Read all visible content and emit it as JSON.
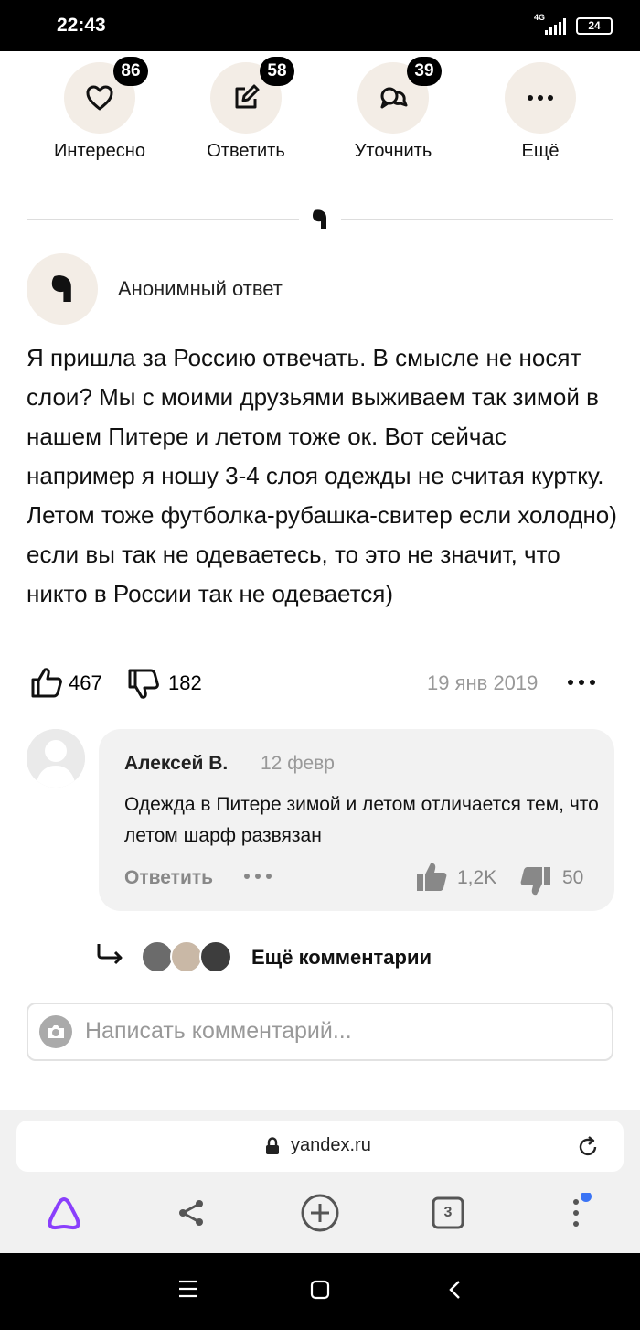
{
  "status_bar": {
    "time": "22:43",
    "network": "4G",
    "battery": "24"
  },
  "actions": [
    {
      "name": "interesting",
      "label": "Интересно",
      "count": "86",
      "icon": "heart-icon"
    },
    {
      "name": "answer",
      "label": "Ответить",
      "count": "58",
      "icon": "edit-icon"
    },
    {
      "name": "clarify",
      "label": "Уточнить",
      "count": "39",
      "icon": "chat-bubbles-icon"
    },
    {
      "name": "more",
      "label": "Ещё",
      "count": null,
      "icon": "more-dots-icon"
    }
  ],
  "answer": {
    "author": "Анонимный ответ",
    "text": "Я пришла за Россию отвечать. В смысле не носят слои? Мы с моими друзьями выживаем так зимой в нашем Питере и летом тоже ок. Вот сейчас например я ношу 3-4 слоя одежды не считая куртку. Летом тоже футболка-рубашка-свитер если холодно) если вы так не одеваетесь, то это не значит, что никто в России так не одевается)",
    "likes": "467",
    "dislikes": "182",
    "date": "19 янв 2019"
  },
  "comment": {
    "author": "Алексей В.",
    "date": "12 февр",
    "text": "Одежда в Питере зимой и летом отличается тем, что летом шарф развязан",
    "reply_label": "Ответить",
    "likes": "1,2K",
    "dislikes": "50"
  },
  "more_comments": {
    "label": "Ещё комментарии"
  },
  "comment_input": {
    "placeholder": "Написать комментарий..."
  },
  "browser": {
    "url": "yandex.ru",
    "tabs_count": "3"
  },
  "colors": {
    "accent_purple": "#8a3ffc",
    "badge_bg": "#000000",
    "action_bg": "#f3ede6",
    "notify_dot": "#3b74f5"
  }
}
